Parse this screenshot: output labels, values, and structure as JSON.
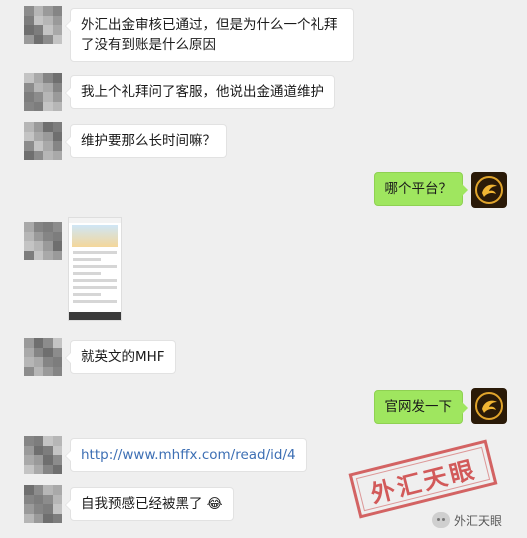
{
  "chat": {
    "messages": [
      {
        "side": "left",
        "text": "外汇出金审核已通过，但是为什么一个礼拜了没有到账是什么原因"
      },
      {
        "side": "left",
        "text": "我上个礼拜问了客服，他说出金通道维护"
      },
      {
        "side": "left",
        "text": "维护要那么长时间嘛？"
      },
      {
        "side": "right",
        "text": "哪个平台？"
      },
      {
        "side": "left",
        "type": "image"
      },
      {
        "side": "left",
        "text": "就英文的MHF"
      },
      {
        "side": "right",
        "text": "官网发一下"
      },
      {
        "side": "left",
        "text": "http://www.mhffx.com/read/id/4",
        "type": "link"
      },
      {
        "side": "left",
        "text": "自我预感已经被黑了",
        "emoji": "😂"
      }
    ]
  },
  "watermark": {
    "stamp_text": "外汇天眼",
    "account": "外汇天眼"
  },
  "colors": {
    "background": "#efefef",
    "bubble_left": "#ffffff",
    "bubble_right": "#9fe65f",
    "link": "#3d6fb4",
    "stamp": "#cc4040"
  }
}
